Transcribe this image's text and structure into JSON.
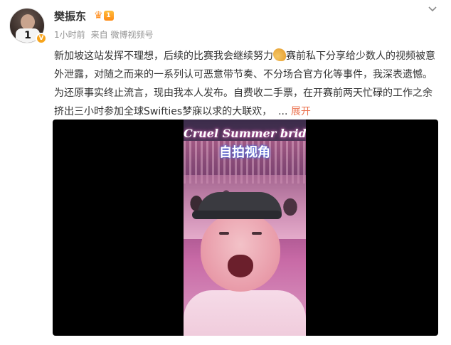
{
  "post": {
    "author": "樊振东",
    "badge_level": "1",
    "avatar_number": "1",
    "verified_mark": "V",
    "time": "1小时前",
    "source": "来自 微博视频号",
    "text_before_emoji": "新加坡这站发挥不理想，后续的比赛我会继续努力",
    "text_after_emoji": "赛前私下分享给少数人的视频被意外泄露，对随之而来的一系列认可恶意带节奏、不分场合官方化等事件，我深表遗憾。为还原事实终止流言，现由我本人发布。自费收二手票，在开赛前两天忙碌的工作之余挤出三小时参加全球Swifties梦寐以求的大联欢，",
    "ellipsis": "...",
    "expand_label": "展开"
  },
  "video": {
    "overlay_title": "Cruel Summer bridge",
    "overlay_caption": "自拍视角"
  },
  "icons": {
    "menu": "chevron-down-icon",
    "crown": "crown-icon",
    "emoji": "flexed-biceps-icon"
  },
  "colors": {
    "link": "#eb7350",
    "meta": "#939393",
    "badge": "#ff8d1e"
  }
}
